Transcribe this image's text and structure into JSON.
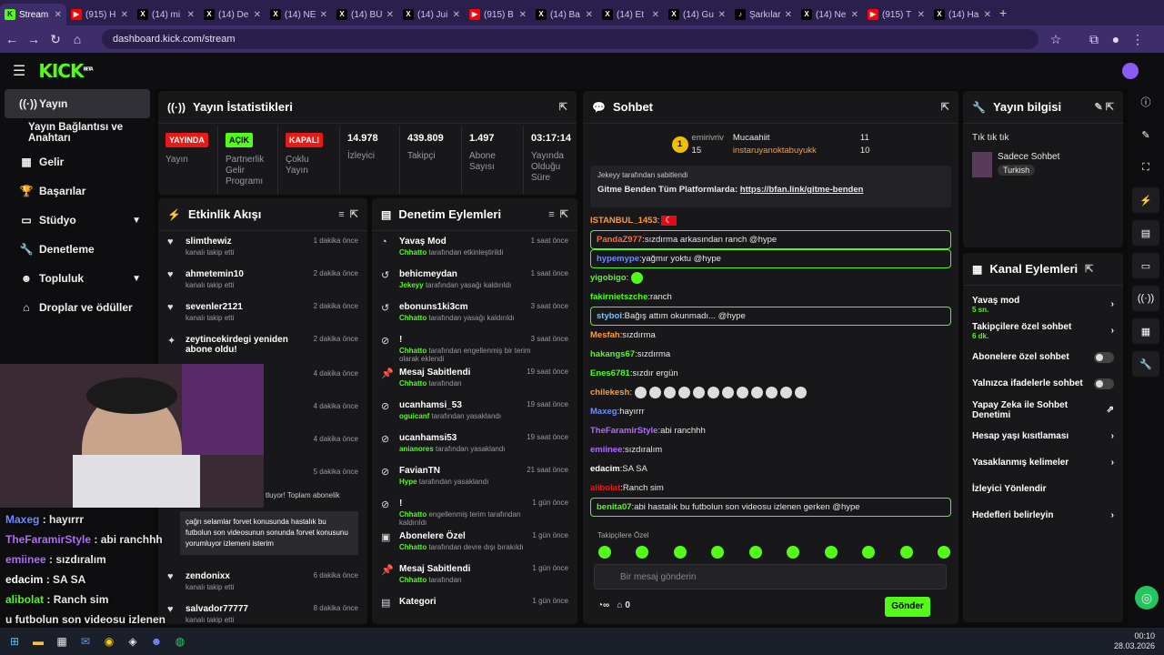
{
  "tabs": [
    {
      "label": "Stream",
      "icon": "kick-favicon",
      "color": "#53fc18"
    },
    {
      "label": "(915) H",
      "icon": "youtube-favicon",
      "color": "#ff0000"
    },
    {
      "label": "(14) mi",
      "icon": "x-favicon",
      "color": "#ffffff"
    },
    {
      "label": "(14) De",
      "icon": "x-favicon",
      "color": "#ffffff"
    },
    {
      "label": "(14) NE",
      "icon": "x-favicon",
      "color": "#ffffff"
    },
    {
      "label": "(14) BÜ",
      "icon": "x-favicon",
      "color": "#ffffff"
    },
    {
      "label": "(14) Jui",
      "icon": "x-favicon",
      "color": "#ffffff"
    },
    {
      "label": "(915) B",
      "icon": "youtube-favicon",
      "color": "#ff0000"
    },
    {
      "label": "(14) Ba",
      "icon": "x-favicon",
      "color": "#ffffff"
    },
    {
      "label": "(14) Et",
      "icon": "x-favicon",
      "color": "#ffffff"
    },
    {
      "label": "(14) Gu",
      "icon": "x-favicon",
      "color": "#ffffff"
    },
    {
      "label": "Şarkılar",
      "icon": "tiktok-favicon",
      "color": "#ffffff"
    },
    {
      "label": "(14) Ne",
      "icon": "x-favicon",
      "color": "#ffffff"
    },
    {
      "label": "(915) T",
      "icon": "youtube-favicon",
      "color": "#ff0000"
    },
    {
      "label": "(14) Ha",
      "icon": "x-favicon",
      "color": "#ffffff"
    }
  ],
  "url": "dashboard.kick.com/stream",
  "logo": "KICK",
  "logo_sup": "BETA",
  "sidebar": {
    "items": [
      {
        "label": "Yayın",
        "icon": "broadcast-icon"
      },
      {
        "label": "Yayın Bağlantısı ve Anahtarı",
        "icon": ""
      },
      {
        "label": "Gelir",
        "icon": "revenue-icon"
      },
      {
        "label": "Başarılar",
        "icon": "trophy-icon"
      },
      {
        "label": "Stüdyo",
        "icon": "studio-icon"
      },
      {
        "label": "Denetleme",
        "icon": "wrench-icon"
      },
      {
        "label": "Topluluk",
        "icon": "community-icon"
      },
      {
        "label": "Droplar ve ödüller",
        "icon": "gift-icon"
      }
    ]
  },
  "stats": {
    "title": "Yayın İstatistikleri",
    "items": [
      {
        "badge": "YAYINDA",
        "badge_color": "#e91916",
        "label": "Yayın"
      },
      {
        "badge": "AÇIK",
        "badge_color": "#53fc18",
        "label": "Partnerlik Gelir Programı"
      },
      {
        "badge": "KAPALI",
        "badge_color": "#e91916",
        "label": "Çoklu Yayın"
      },
      {
        "value": "14.978",
        "label": "İzleyici"
      },
      {
        "value": "439.809",
        "label": "Takipçi"
      },
      {
        "value": "1.497",
        "label": "Abone Sayısı"
      },
      {
        "value": "03:17:14",
        "label": "Yayında Olduğu Süre"
      }
    ]
  },
  "feed": {
    "title": "Etkinlik Akışı",
    "items": [
      {
        "name": "slimthewiz",
        "sub": "kanalı takip etti",
        "time": "1 dakika önce"
      },
      {
        "name": "ahmetemin10",
        "sub": "kanalı takip etti",
        "time": "2 dakika önce"
      },
      {
        "name": "sevenler2121",
        "sub": "kanalı takip etti",
        "time": "2 dakika önce"
      },
      {
        "name": "zeytincekirdegi yeniden abone oldu!",
        "sub": "",
        "time": "2 dakika önce"
      },
      {
        "name": "zendonixx",
        "sub": "kanalı takip etti",
        "time": "6 dakika önce"
      },
      {
        "name": "salvador77777",
        "sub": "kanalı takip etti",
        "time": "8 dakika önce"
      }
    ],
    "hidden_times": [
      "4 dakika önce",
      "4 dakika önce",
      "4 dakika önce",
      "5 dakika önce"
    ],
    "sub_snippet": "tluyor! Toplam abonelik",
    "sub_message": "çağrı selamlar forvet konusunda hastalık bu futbolun son videosunun sonunda forvet konusunu yorumluyor izlemeni isterim"
  },
  "mod": {
    "title": "Denetim Eylemleri",
    "items": [
      {
        "name": "Yavaş Mod",
        "actor": "Chhatto",
        "sub": "tarafından etkinleştirildi",
        "time": "1 saat önce"
      },
      {
        "name": "behicmeydan",
        "actor": "Jekeyy",
        "sub": "tarafından yasağı kaldırıldı",
        "time": "1 saat önce"
      },
      {
        "name": "ebonuns1ki3cm",
        "actor": "Chhatto",
        "sub": "tarafından yasağı kaldırıldı",
        "time": "3 saat önce"
      },
      {
        "name": "!",
        "actor": "Chhatto",
        "sub": "tarafından engellenmiş bir terim olarak eklendi",
        "time": "3 saat önce"
      },
      {
        "name": "Mesaj Sabitlendi",
        "actor": "Chhatto",
        "sub": "tarafından",
        "time": "19 saat önce"
      },
      {
        "name": "ucanhamsi_53",
        "actor": "oguicanf",
        "sub": "tarafından yasaklandı",
        "time": "19 saat önce"
      },
      {
        "name": "ucanhamsi53",
        "actor": "anianores",
        "sub": "tarafından yasaklandı",
        "time": "19 saat önce"
      },
      {
        "name": "FavianTN",
        "actor": "Hype",
        "sub": "tarafından yasaklandı",
        "time": "21 saat önce"
      },
      {
        "name": "!",
        "actor": "Chhatto",
        "sub": "engellenmiş terim  tarafından kaldırıldı",
        "time": "1 gün önce"
      },
      {
        "name": "Abonelere Özel",
        "actor": "Chhatto",
        "sub": "tarafından devre dışı bırakıldı",
        "time": "1 gün önce"
      },
      {
        "name": "Mesaj Sabitlendi",
        "actor": "Chhatto",
        "sub": "tarafından",
        "time": "1 gün önce"
      },
      {
        "name": "Kategori",
        "actor": "",
        "sub": "",
        "time": "1 gün önce"
      }
    ]
  },
  "chat": {
    "title": "Sohbet",
    "top": [
      {
        "name": "emirivriv",
        "count": "15"
      },
      {
        "name": "Mucaahiit",
        "count": "11"
      },
      {
        "name": "instaruyanoktabuyukk",
        "count": "10"
      }
    ],
    "pinned_by": "Jekeyy tarafından sabitlendi",
    "pinned_text": "Gitme Benden Tüm Platformlarda: ",
    "pinned_link": "https://bfan.link/gitme-benden",
    "messages": [
      {
        "user": "ISTANBUL_1453",
        "color": "#ff9a3c",
        "text": "",
        "box": false
      },
      {
        "user": "PandaZ977",
        "color": "#ff6b3c",
        "text": "sızdırma arkasından ranch @hype",
        "box": true
      },
      {
        "user": "hypemype",
        "color": "#6e8cff",
        "text": "yağmır yoktu @hype",
        "box": true
      },
      {
        "user": "yigobigo",
        "color": "#53fc18",
        "text": "",
        "box": false
      },
      {
        "user": "fakirnietszche",
        "color": "#53fc18",
        "text": "ranch",
        "box": false
      },
      {
        "user": "styboi",
        "color": "#6ec6ff",
        "text": "Bağış attım okunmadı... @hype",
        "box": true
      },
      {
        "user": "Mesfah",
        "color": "#ff9a3c",
        "text": "sızdırma",
        "box": false
      },
      {
        "user": "hakangs67",
        "color": "#53fc18",
        "text": "sızdırma",
        "box": false
      },
      {
        "user": "Enes6781",
        "color": "#53fc18",
        "text": "sızdır ergün",
        "box": false
      },
      {
        "user": "chilekesh",
        "color": "#ff9a3c",
        "text": "",
        "box": false
      },
      {
        "user": "Maxeg",
        "color": "#6e8cff",
        "text": "hayırrr",
        "box": false
      },
      {
        "user": "TheFaramirStyle",
        "color": "#b36bff",
        "text": "abi ranchhh",
        "box": false
      },
      {
        "user": "emiinee",
        "color": "#b36bff",
        "text": "sızdıralım",
        "box": false
      },
      {
        "user": "edacim",
        "color": "#ffffff",
        "text": "SA SA",
        "box": false
      },
      {
        "user": "alibolat",
        "color": "#e91916",
        "text": "Ranch sim",
        "box": false
      },
      {
        "user": "benita07",
        "color": "#53fc18",
        "text": "abi hastalık bu futbolun son videosu izlenen gerken @hype",
        "box": true
      }
    ],
    "follower_only": "Takipçilere Özel",
    "input_placeholder": "Bir mesaj gönderin",
    "points": "0",
    "send": "Gönder"
  },
  "info": {
    "title": "Yayın bilgisi",
    "stream_title": "Tık tık tık",
    "category": "Sadece Sohbet",
    "tag": "Turkish"
  },
  "actions": {
    "title": "Kanal Eylemleri",
    "items": [
      {
        "label": "Yavaş mod",
        "sub": "5 sn.",
        "ctrl": "chevron"
      },
      {
        "label": "Takipçilere özel sohbet",
        "sub": "6 dk.",
        "ctrl": "chevron"
      },
      {
        "label": "Abonelere özel sohbet",
        "sub": "",
        "ctrl": "toggle"
      },
      {
        "label": "Yalnızca ifadelerle sohbet",
        "sub": "",
        "ctrl": "toggle"
      },
      {
        "label": "Yapay Zeka ile Sohbet Denetimi",
        "sub": "",
        "ctrl": "external"
      },
      {
        "label": "Hesap yaşı kısıtlaması",
        "sub": "",
        "ctrl": "chevron"
      },
      {
        "label": "Yasaklanmış kelimeler",
        "sub": "",
        "ctrl": "chevron"
      },
      {
        "label": "İzleyici Yönlendir",
        "sub": "",
        "ctrl": ""
      },
      {
        "label": "Hedefleri belirleyin",
        "sub": "",
        "ctrl": "chevron"
      }
    ]
  },
  "overlay": [
    {
      "user": "Maxeg",
      "color": "#6e8cff",
      "text": "hayırrr"
    },
    {
      "user": "TheFaramirStyle",
      "color": "#b36bff",
      "text": "abi ranchhh"
    },
    {
      "user": "emiinee",
      "color": "#b36bff",
      "text": "sızdıralım"
    },
    {
      "user": "edacim",
      "color": "#ffffff",
      "text": "SA SA"
    },
    {
      "user": "alibolat",
      "color": "#53fc18",
      "text": "Ranch sim"
    },
    {
      "user": "",
      "color": "#ffffff",
      "text": "u futbolun son videosu izlenen"
    }
  ],
  "clock": {
    "time": "00:10",
    "date": "28.03.2026"
  }
}
